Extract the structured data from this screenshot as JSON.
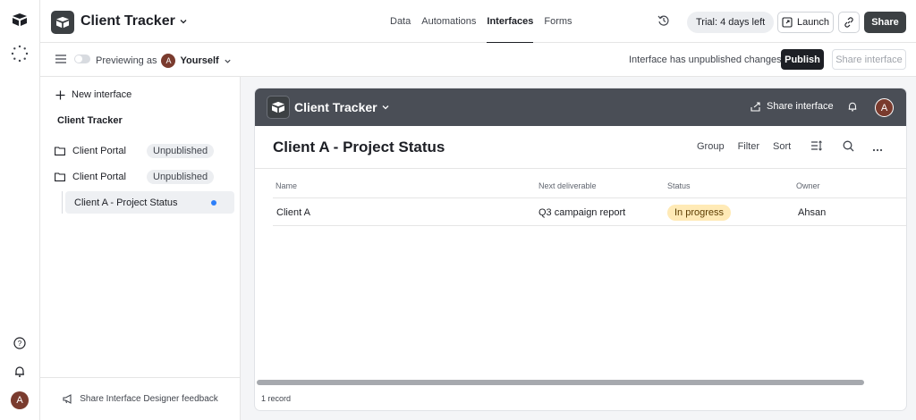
{
  "app": {
    "base_name": "Client Tracker",
    "nav": [
      "Data",
      "Automations",
      "Interfaces",
      "Forms"
    ],
    "active_nav": "Interfaces",
    "trial": "Trial: 4 days left",
    "launch": "Launch",
    "share": "Share",
    "user_initial": "A"
  },
  "subbar": {
    "previewing_label": "Previewing as",
    "previewing_user": "Yourself",
    "unpublished_msg": "Interface has unpublished changes",
    "publish": "Publish",
    "share_interface": "Share interface"
  },
  "sidebar": {
    "new_interface": "New interface",
    "group": "Client Tracker",
    "items": [
      {
        "label": "Client Portal",
        "badge": "Unpublished"
      },
      {
        "label": "Client Portal",
        "badge": "Unpublished"
      }
    ],
    "selected_page": "Client A - Project Status",
    "feedback": "Share Interface Designer feedback"
  },
  "interface": {
    "header_title": "Client Tracker",
    "share_interface": "Share interface",
    "page_title": "Client A - Project Status",
    "toolbar": [
      "Group",
      "Filter",
      "Sort"
    ],
    "columns": [
      "Name",
      "Next deliverable",
      "Status",
      "Owner"
    ],
    "rows": [
      {
        "name": "Client A",
        "next_deliverable": "Q3 campaign report",
        "status": "In progress",
        "owner": "Ahsan"
      }
    ],
    "record_count": "1 record"
  },
  "colors": {
    "accent_dark": "#3c4043",
    "status_in_progress": "#ffeab6",
    "selected_dot": "#2d7ff9"
  }
}
